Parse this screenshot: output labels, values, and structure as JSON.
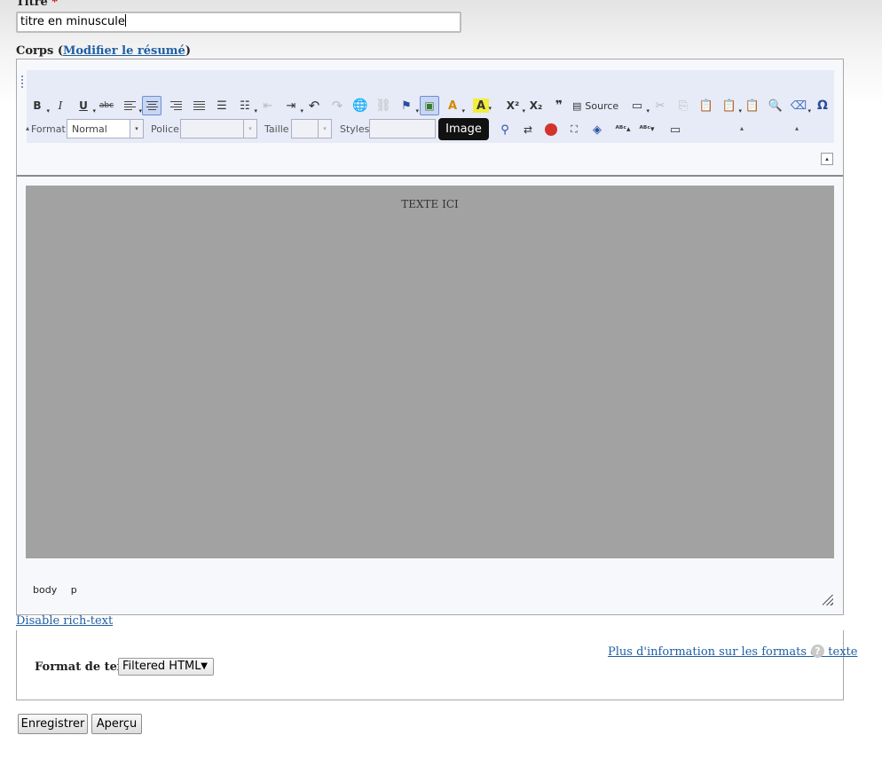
{
  "title_field": {
    "label": "Titre",
    "required_mark": "*",
    "value": "titre en minuscule"
  },
  "body_field": {
    "label": "Corps",
    "open_paren": "(",
    "summary_link": "Modifier le résumé",
    "close_paren": ")"
  },
  "toolbar": {
    "row1": {
      "bold": "B",
      "italic": "I",
      "underline": "U",
      "strike": "abc",
      "superscript": "X²",
      "subscript": "X₂",
      "blockquote": "❞",
      "source_label": "Source",
      "special_char": "Ω"
    },
    "row2": {
      "format_label": "Format",
      "format_value": "Normal",
      "font_label": "Police",
      "size_label": "Taille",
      "styles_label": "Styles"
    },
    "tooltip": "Image"
  },
  "content": {
    "text": "TEXTE ICI",
    "background": "#a2a2a2"
  },
  "path_bar": [
    "body",
    "p"
  ],
  "disable_rich_text": "Disable rich-text",
  "text_format": {
    "label": "Format de texte",
    "selected": "Filtered HTML",
    "more_info_link": "Plus d'information sur les formats de texte",
    "help_icon": "question-icon"
  },
  "buttons": {
    "save": "Enregistrer",
    "preview": "Aperçu"
  },
  "colors": {
    "link": "#1f5fa3",
    "required": "#cc0000",
    "toolbar_bg": "#e7eaf7",
    "active_button": "#c8d6f3"
  }
}
